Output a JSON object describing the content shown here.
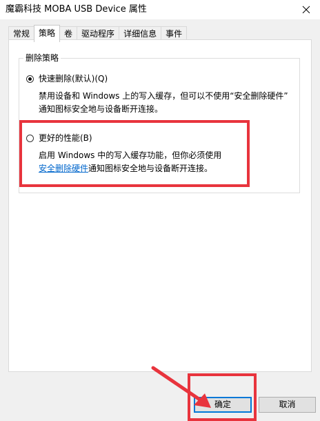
{
  "window": {
    "title": "魔霸科技 MOBA USB Device 属性",
    "close_icon": "×"
  },
  "tabs": [
    {
      "label": "常规",
      "active": false
    },
    {
      "label": "策略",
      "active": true
    },
    {
      "label": "卷",
      "active": false
    },
    {
      "label": "驱动程序",
      "active": false
    },
    {
      "label": "详细信息",
      "active": false
    },
    {
      "label": "事件",
      "active": false
    }
  ],
  "removal_policy": {
    "group_title": "删除策略",
    "quick_removal": {
      "label": "快速删除(默认)(Q)",
      "selected": true,
      "desc_line1": "禁用设备和 Windows 上的写入缓存，但可以不使用“安全删除硬件”",
      "desc_line2": "通知图标安全地与设备断开连接。"
    },
    "better_performance": {
      "label": "更好的性能(B)",
      "selected": false,
      "desc_line1": "启用 Windows 中的写入缓存功能，但你必须使用",
      "desc_link": "安全删除硬件",
      "desc_line2_rest": "通知图标安全地与设备断开连接。"
    }
  },
  "buttons": {
    "ok": "确定",
    "cancel": "取消"
  },
  "colors": {
    "highlight": "#e8343d",
    "link": "#0066cc",
    "dialog_bg": "#f0f0f0",
    "default_button_border": "#0078d7"
  }
}
